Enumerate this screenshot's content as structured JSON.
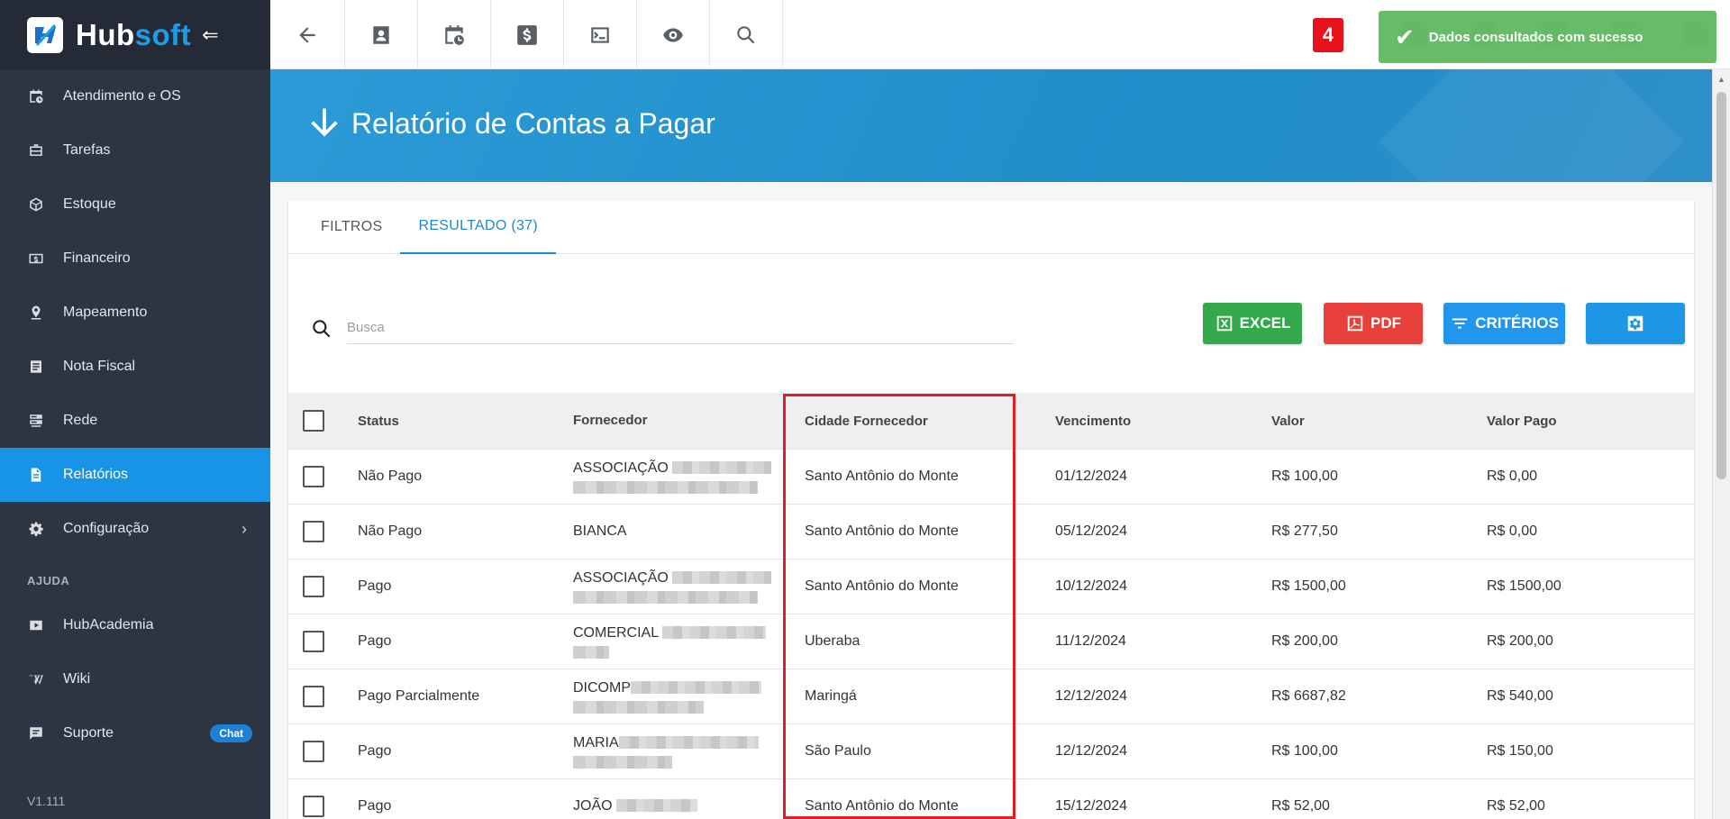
{
  "app": {
    "logo_hub": "Hub",
    "logo_soft": "soft"
  },
  "sidebar": {
    "items": [
      {
        "label": "Atendimento e OS"
      },
      {
        "label": "Tarefas"
      },
      {
        "label": "Estoque"
      },
      {
        "label": "Financeiro"
      },
      {
        "label": "Mapeamento"
      },
      {
        "label": "Nota Fiscal"
      },
      {
        "label": "Rede"
      },
      {
        "label": "Relatórios"
      },
      {
        "label": "Configuração"
      }
    ],
    "help_label": "AJUDA",
    "help_items": [
      {
        "label": "HubAcademia"
      },
      {
        "label": "Wiki"
      },
      {
        "label": "Suporte",
        "badge": "Chat"
      }
    ],
    "version": "V1.111"
  },
  "topbar": {
    "notification_count": "4"
  },
  "toast": {
    "message": "Dados consultados com sucesso"
  },
  "banner": {
    "title": "Relatório de Contas a Pagar"
  },
  "tabs": [
    {
      "label": "FILTROS"
    },
    {
      "label": "RESULTADO (37)"
    }
  ],
  "search": {
    "placeholder": "Busca",
    "value": ""
  },
  "actions": {
    "excel": "EXCEL",
    "pdf": "PDF",
    "criteria": "CRITÉRIOS"
  },
  "table": {
    "columns": [
      "Status",
      "Fornecedor",
      "Cidade Fornecedor",
      "Vencimento",
      "Valor",
      "Valor Pago"
    ],
    "rows": [
      {
        "status": "Não Pago",
        "fornecedor": "ASSOCIAÇÃO",
        "cidade": "Santo Antônio do Monte",
        "vencimento": "01/12/2024",
        "valor": "R$ 100,00",
        "valor_pago": "R$ 0,00"
      },
      {
        "status": "Não Pago",
        "fornecedor": "BIANCA",
        "cidade": "Santo Antônio do Monte",
        "vencimento": "05/12/2024",
        "valor": "R$ 277,50",
        "valor_pago": "R$ 0,00"
      },
      {
        "status": "Pago",
        "fornecedor": "ASSOCIAÇÃO",
        "cidade": "Santo Antônio do Monte",
        "vencimento": "10/12/2024",
        "valor": "R$ 1500,00",
        "valor_pago": "R$ 1500,00"
      },
      {
        "status": "Pago",
        "fornecedor": "COMERCIAL",
        "cidade": "Uberaba",
        "vencimento": "11/12/2024",
        "valor": "R$ 200,00",
        "valor_pago": "R$ 200,00"
      },
      {
        "status": "Pago Parcialmente",
        "fornecedor": "DICOMP",
        "cidade": "Maringá",
        "vencimento": "12/12/2024",
        "valor": "R$ 6687,82",
        "valor_pago": "R$ 540,00"
      },
      {
        "status": "Pago",
        "fornecedor": "MARIA",
        "cidade": "São Paulo",
        "vencimento": "12/12/2024",
        "valor": "R$ 100,00",
        "valor_pago": "R$ 150,00"
      },
      {
        "status": "Pago",
        "fornecedor": "JOÃO",
        "cidade": "Santo Antônio do Monte",
        "vencimento": "15/12/2024",
        "valor": "R$ 52,00",
        "valor_pago": "R$ 52,00"
      }
    ]
  },
  "colors": {
    "sidebar_bg": "#2e3542",
    "active_nav": "#1794e6",
    "banner": "#2294d0",
    "excel": "#32a94a",
    "pdf": "#e8413b",
    "criteria": "#2196ea",
    "highlight": "#e31b23"
  }
}
